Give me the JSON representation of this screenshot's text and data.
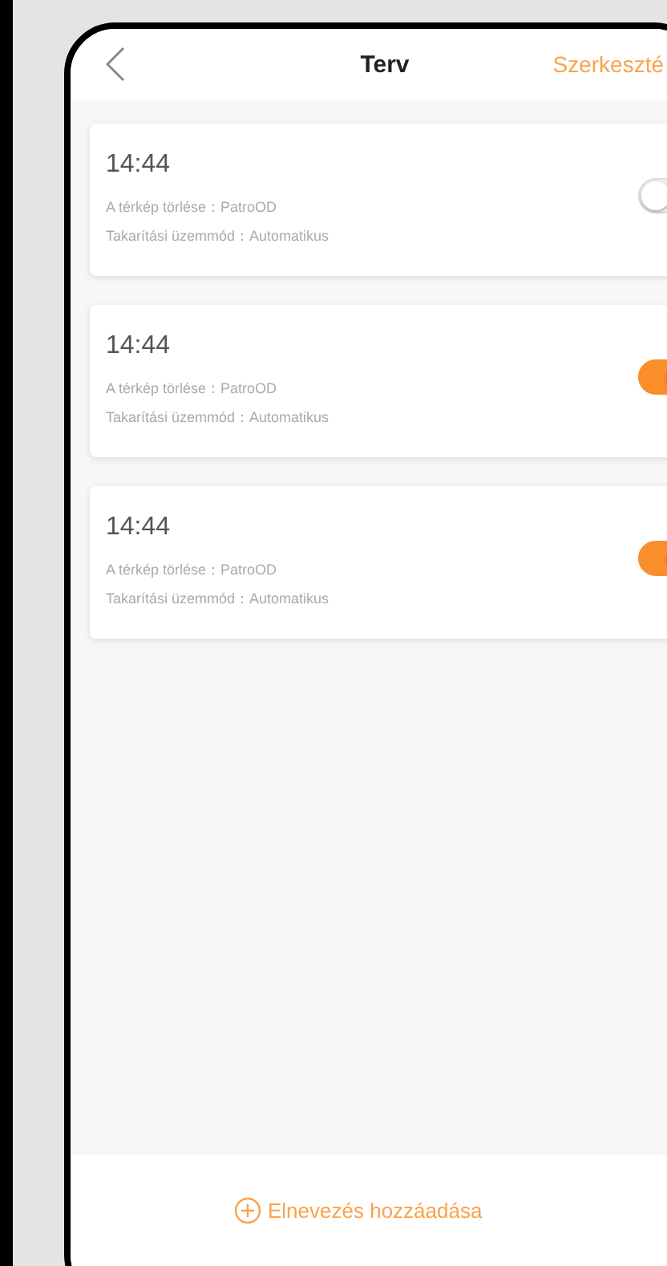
{
  "header": {
    "title": "Terv",
    "edit": "Szerkeszté"
  },
  "plans": [
    {
      "time": "14:44",
      "map": "A térkép törlése：PatroOD",
      "mode": "Takarítási üzemmód：Automatikus",
      "on": false
    },
    {
      "time": "14:44",
      "map": "A térkép törlése：PatroOD",
      "mode": "Takarítási üzemmód：Automatikus",
      "on": true
    },
    {
      "time": "14:44",
      "map": "A térkép törlése：PatroOD",
      "mode": "Takarítási üzemmód：Automatikus",
      "on": true
    }
  ],
  "footer": {
    "add": "Elnevezés hozzáadása"
  }
}
